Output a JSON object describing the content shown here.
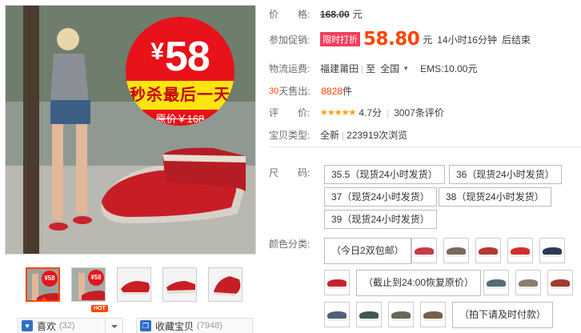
{
  "promo": {
    "currency": "¥",
    "price": "58",
    "banner": "秒杀最后一天",
    "original": "原价￥168"
  },
  "thumbnails": [
    {
      "label": "¥58"
    },
    {
      "label": "¥58"
    },
    {
      "label": ""
    },
    {
      "label": ""
    },
    {
      "label": ""
    }
  ],
  "actions": {
    "like_label": "喜欢",
    "like_count": "(32)",
    "hot_badge": "HOT",
    "fav_label": "收藏宝贝",
    "fav_count": "(7948)",
    "like_icon": "heart-icon",
    "fav_icon": "bookmark-icon"
  },
  "info": {
    "price_label": "价　　格:",
    "price_value": "168.00",
    "price_unit": "元",
    "promo_label": "参加促销:",
    "promo_tag": "限时打折",
    "promo_price": "58.80",
    "promo_unit": "元",
    "promo_time": "14小时16分钟",
    "promo_end": "后结束",
    "ship_label": "物流运费:",
    "ship_from": "福建莆田",
    "ship_to_prefix": "至",
    "ship_to": "全国",
    "ship_fee": "EMS:10.00元",
    "sold_days": "30",
    "sold_label": "天售出:",
    "sold_count": "8828",
    "sold_unit": "件",
    "rate_label": "评　　价:",
    "rate_stars": "★★★★★",
    "rate_score": "4.7分",
    "rate_count": "3007条评价",
    "type_label": "宝贝类型:",
    "type_value": "全新",
    "views": "223919次浏览"
  },
  "sizes": {
    "label": "尺　　码:",
    "options": [
      "35.5（现货24小时发货）",
      "36（现货24小时发货）",
      "37（现货24小时发货）",
      "38（现货24小时发货）",
      "39（现货24小时发货）"
    ]
  },
  "colors": {
    "label": "颜色分类:",
    "text_options": [
      "（今日2双包邮）",
      "（截止到24:00恢复原价）",
      "（拍下请及时付款）"
    ],
    "swatch_colors": [
      "#c73a4a",
      "#7a6a5c",
      "#b03a36",
      "#d12f2a",
      "#2b3b56",
      "#c8232a",
      "#4f6f77",
      "#8a7f6e",
      "#a33b31",
      "#506079",
      "#3d5a4d",
      "#5f6a58",
      "#73604a"
    ]
  }
}
